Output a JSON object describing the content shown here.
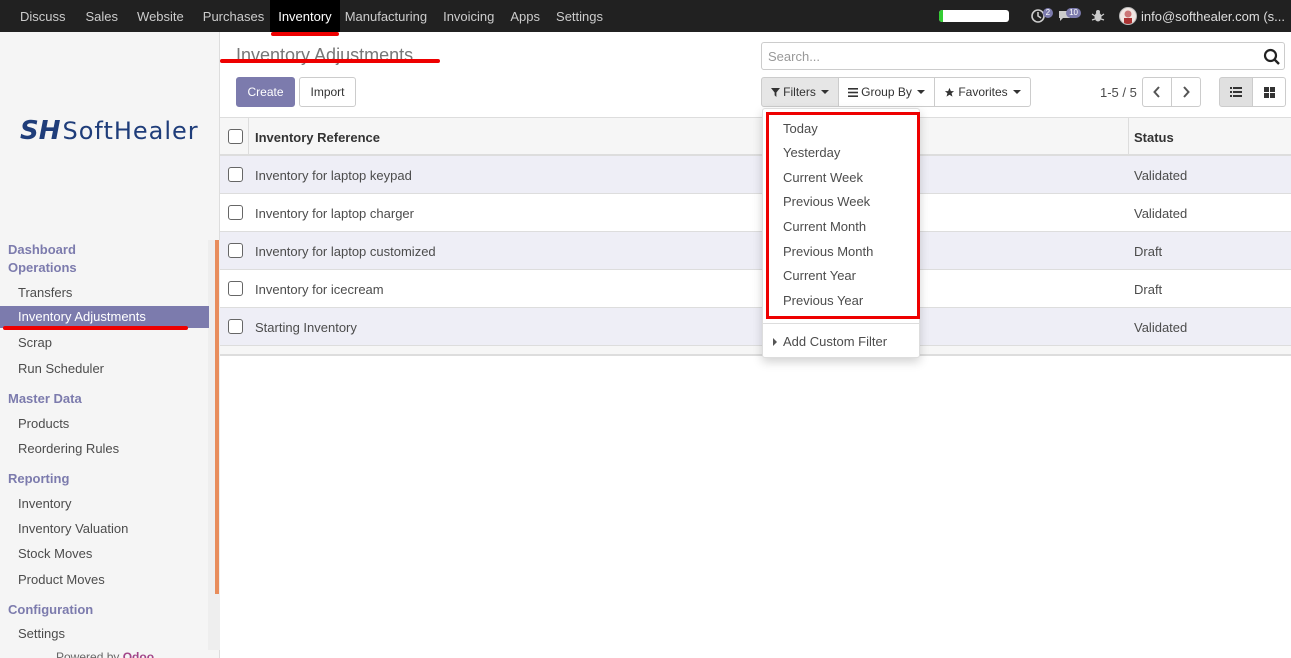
{
  "topnav": {
    "menu": [
      "Discuss",
      "Sales",
      "Website",
      "Purchases",
      "Inventory",
      "Manufacturing",
      "Invoicing",
      "Apps",
      "Settings"
    ],
    "active_index": 4,
    "progress_fraction": 0.05,
    "activity_badge": "2",
    "messages_badge": "10",
    "user": "info@softhealer.com (s..."
  },
  "sidebar": {
    "logo_mark": "SH",
    "logo_text": "SoftHealer",
    "sections": [
      {
        "title": "Dashboard",
        "items": []
      },
      {
        "title": "Operations",
        "items": [
          "Transfers",
          "Inventory Adjustments",
          "Scrap",
          "Run Scheduler"
        ]
      },
      {
        "title": "Master Data",
        "items": [
          "Products",
          "Reordering Rules"
        ]
      },
      {
        "title": "Reporting",
        "items": [
          "Inventory",
          "Inventory Valuation",
          "Stock Moves",
          "Product Moves"
        ]
      },
      {
        "title": "Configuration",
        "items": [
          "Settings"
        ]
      }
    ],
    "active_item": "Inventory Adjustments",
    "powered_by": "Powered by",
    "powered_brand": "Odoo"
  },
  "main": {
    "breadcrumb": "Inventory Adjustments",
    "create_label": "Create",
    "import_label": "Import",
    "search_placeholder": "Search...",
    "filters_label": "Filters",
    "groupby_label": "Group By",
    "favorites_label": "Favorites",
    "pager": "1-5 / 5",
    "columns": [
      "Inventory Reference",
      "Status"
    ],
    "rows": [
      {
        "ref": "Inventory for laptop keypad",
        "status": "Validated"
      },
      {
        "ref": "Inventory for laptop charger",
        "status": "Validated"
      },
      {
        "ref": "Inventory for laptop customized",
        "status": "Draft"
      },
      {
        "ref": "Inventory for icecream",
        "status": "Draft"
      },
      {
        "ref": "Starting Inventory",
        "status": "Validated"
      }
    ]
  },
  "filters_dropdown": {
    "items": [
      "Today",
      "Yesterday",
      "Current Week",
      "Previous Week",
      "Current Month",
      "Previous Month",
      "Current Year",
      "Previous Year"
    ],
    "custom_label": "Add Custom Filter"
  },
  "colors": {
    "accent": "#7c7bad",
    "highlight": "#ee0000",
    "navbar": "#212121"
  }
}
